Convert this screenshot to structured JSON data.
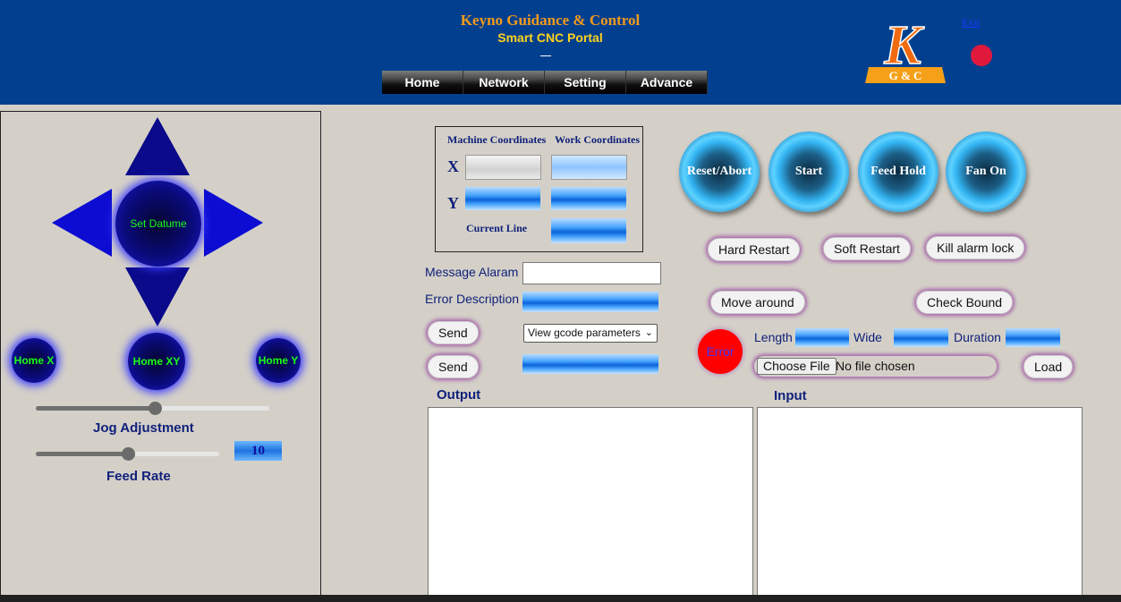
{
  "header": {
    "title": "Keyno Guidance & Control",
    "subtitle": "Smart CNC Portal",
    "nav": [
      "Home",
      "Network",
      "Setting",
      "Advance"
    ],
    "exit_label": "Exit",
    "logo_letter": "K",
    "logo_text": "G & C",
    "colors": {
      "background": "#02408f",
      "title": "#f39a1c",
      "subtitle": "#ffd21c",
      "status_dot": "#e0193c"
    }
  },
  "jog": {
    "set_datume": "Set Datume",
    "home_x": "Home X",
    "home_xy": "Home XY",
    "home_y": "Home Y",
    "jog_adjustment_label": "Jog Adjustment",
    "jog_adjustment_fraction": 0.51,
    "feed_rate_label": "Feed Rate",
    "feed_rate_fraction": 0.5,
    "feed_rate_value": "10"
  },
  "coordinates": {
    "machine_label": "Machine Coordinates",
    "work_label": "Work Coordinates",
    "x_label": "X",
    "y_label": "Y",
    "current_line_label": "Current Line"
  },
  "messages": {
    "message_alarm_label": "Message Alaram",
    "message_alarm_value": "",
    "error_description_label": "Error Description",
    "send_label": "Send",
    "gcode_select": "View gcode parameters"
  },
  "controls": {
    "reset_abort": "Reset/Abort",
    "start": "Start",
    "feed_hold": "Feed Hold",
    "fan_on": "Fan On",
    "hard_restart": "Hard Restart",
    "soft_restart": "Soft Restart",
    "kill_alarm_lock": "Kill alarm lock",
    "move_around": "Move around",
    "check_bound": "Check Bound",
    "error": "Error",
    "length_label": "Length",
    "wide_label": "Wide",
    "duration_label": "Duration",
    "choose_file": "Choose File",
    "no_file": "No file chosen",
    "load": "Load"
  },
  "io": {
    "output_label": "Output",
    "input_label": "Input"
  }
}
